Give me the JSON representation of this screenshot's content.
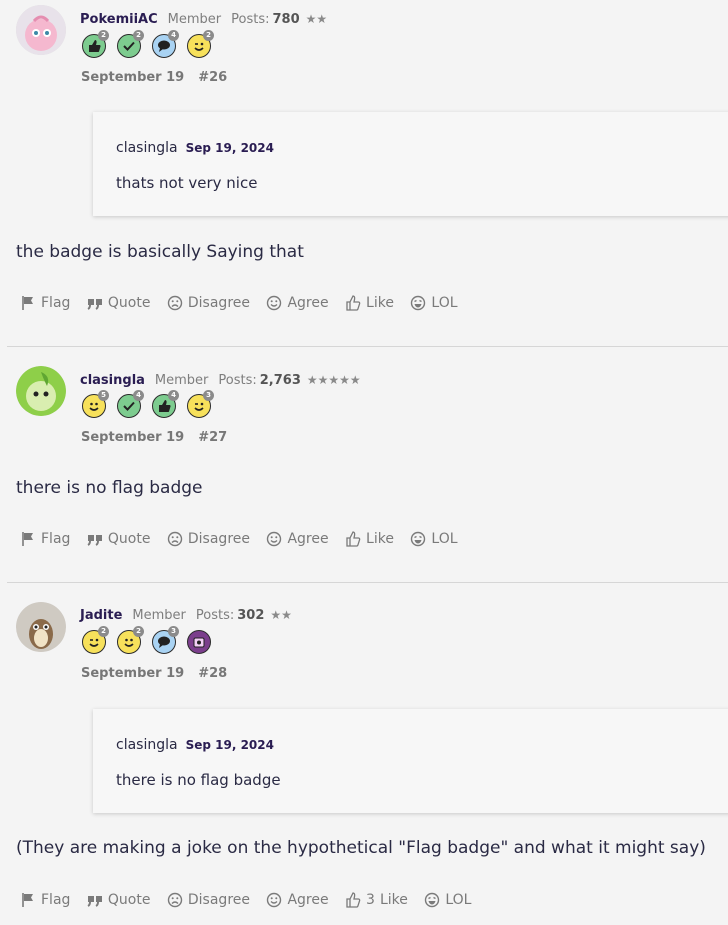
{
  "posts": [
    {
      "username": "PokemiiAC",
      "role": "Member",
      "posts_label": "Posts:",
      "posts_count": "780",
      "stars": "★★",
      "badges": [
        {
          "icon": "thumbs-up-icon",
          "color": "#7dcc8f",
          "count": "2"
        },
        {
          "icon": "check-icon",
          "color": "#7dcc8f",
          "count": "2"
        },
        {
          "icon": "speech-bubble-icon",
          "color": "#a9d3f3",
          "count": "4"
        },
        {
          "icon": "wink-face-icon",
          "color": "#f7e15b",
          "count": "2"
        }
      ],
      "date": "September 19",
      "number": "#26",
      "quote": {
        "author": "clasingla",
        "date": "Sep 19, 2024",
        "text": "thats not very nice"
      },
      "message": "the badge is basically Saying that",
      "actions": {
        "flag": "Flag",
        "quote": "Quote",
        "disagree": "Disagree",
        "agree": "Agree",
        "like": "Like",
        "lol": "LOL"
      }
    },
    {
      "username": "clasingla",
      "role": "Member",
      "posts_label": "Posts:",
      "posts_count": "2,763",
      "stars": "★★★★★",
      "badges": [
        {
          "icon": "smile-face-icon",
          "color": "#f7e15b",
          "count": "5"
        },
        {
          "icon": "check-icon",
          "color": "#7dcc8f",
          "count": "4"
        },
        {
          "icon": "thumbs-up-icon",
          "color": "#7dcc8f",
          "count": "4"
        },
        {
          "icon": "wink-face-icon",
          "color": "#f7e15b",
          "count": "3"
        }
      ],
      "date": "September 19",
      "number": "#27",
      "message": "there is no flag badge",
      "actions": {
        "flag": "Flag",
        "quote": "Quote",
        "disagree": "Disagree",
        "agree": "Agree",
        "like": "Like",
        "lol": "LOL"
      }
    },
    {
      "username": "Jadite",
      "role": "Member",
      "posts_label": "Posts:",
      "posts_count": "302",
      "stars": "★★",
      "badges": [
        {
          "icon": "wink-face-icon",
          "color": "#f7e15b",
          "count": "2"
        },
        {
          "icon": "smile-face-icon",
          "color": "#f7e15b",
          "count": "2"
        },
        {
          "icon": "speech-bubble-icon",
          "color": "#a9d3f3",
          "count": "3"
        },
        {
          "icon": "calendar-icon",
          "color": "#7b3e8c",
          "count": ""
        }
      ],
      "date": "September 19",
      "number": "#28",
      "quote": {
        "author": "clasingla",
        "date": "Sep 19, 2024",
        "text": "there is no flag badge"
      },
      "message": "(They are making a joke on the hypothetical \"Flag badge\" and what it might say)",
      "actions": {
        "flag": "Flag",
        "quote": "Quote",
        "disagree": "Disagree",
        "agree": "Agree",
        "like_count": "3",
        "like": "Like",
        "lol": "LOL"
      }
    }
  ]
}
